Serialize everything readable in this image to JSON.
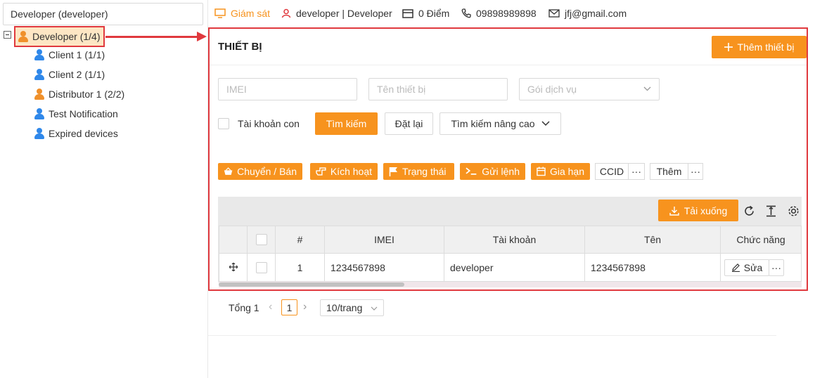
{
  "sidebar": {
    "account_select": "Developer (developer)",
    "root": {
      "label": "Developer (1/4)",
      "icon": "user-orange-icon"
    },
    "children": [
      {
        "label": "Client 1 (1/1)",
        "icon": "user-blue-icon"
      },
      {
        "label": "Client 2 (1/1)",
        "icon": "user-blue-icon"
      },
      {
        "label": "Distributor 1 (2/2)",
        "icon": "user-orange-icon"
      },
      {
        "label": "Test Notification",
        "icon": "user-blue-icon"
      },
      {
        "label": "Expired devices",
        "icon": "user-blue-icon"
      }
    ]
  },
  "topbar": {
    "monitor": "Giám sát",
    "user": "developer | Developer",
    "points": "0 Điểm",
    "phone": "09898989898",
    "email": "jfj@gmail.com"
  },
  "panel": {
    "title": "THIẾT BỊ",
    "add_button": "Thêm thiết bị",
    "filters": {
      "imei_placeholder": "IMEI",
      "name_placeholder": "Tên thiết bị",
      "package_placeholder": "Gói dịch vụ",
      "sub_account_label": "Tài khoản con",
      "search": "Tìm kiếm",
      "reset": "Đặt lại",
      "advanced": "Tìm kiếm nâng cao"
    },
    "actions": {
      "transfer": "Chuyển / Bán",
      "activate": "Kích hoạt",
      "status": "Trạng thái",
      "command": "Gửi lệnh",
      "renew": "Gia hạn",
      "ccid": "CCID",
      "more": "Thêm",
      "ellipsis": "···"
    },
    "table": {
      "download": "Tải xuống",
      "columns": [
        "#",
        "IMEI",
        "Tài khoản",
        "Tên",
        "Chức năng"
      ],
      "rows": [
        {
          "index": "1",
          "imei": "1234567898",
          "account": "developer",
          "name": "1234567898",
          "edit": "Sửa",
          "more": "···"
        }
      ]
    }
  },
  "pager": {
    "total_label": "Tổng 1",
    "current_page": "1",
    "page_size": "10/trang"
  },
  "colors": {
    "accent": "#f7931e",
    "highlight": "#e0393e",
    "user_blue": "#2f88ea"
  }
}
